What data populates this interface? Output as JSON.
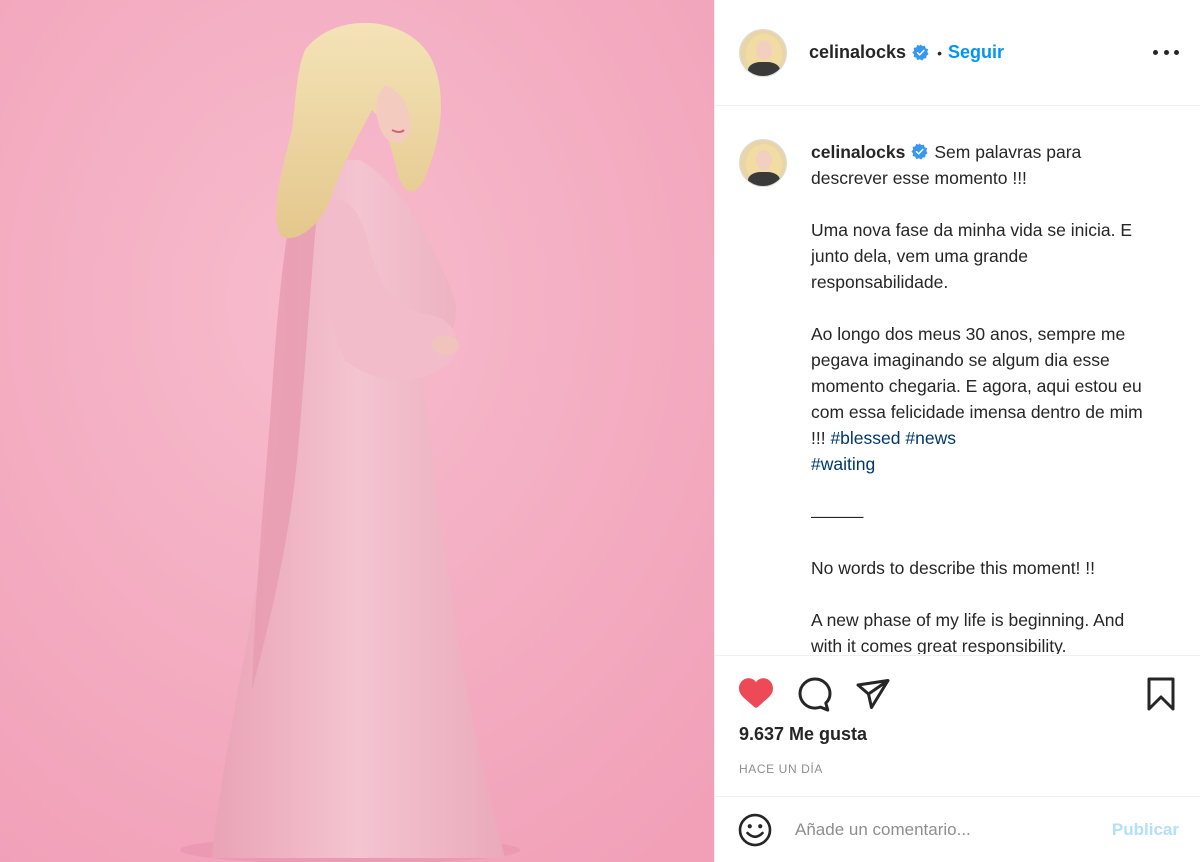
{
  "post": {
    "username": "celinalocks",
    "follow_label": "Seguir",
    "separator": "•"
  },
  "caption": {
    "username": "celinalocks",
    "paragraph1": "Sem palavras para descrever esse momento !!!",
    "paragraph2": "Uma nova fase da minha vida se inicia. E junto dela, vem uma grande responsabilidade.",
    "paragraph3": "Ao longo dos meus 30 anos, sempre me pegava imaginando se algum dia esse momento chegaria. E agora, aqui estou eu com essa felicidade imensa dentro de mim !!! ",
    "hashtags": [
      "#blessed",
      "#news",
      "#waiting"
    ],
    "divider": "———",
    "paragraph4": "No words to describe this moment! !!",
    "paragraph5": "A new phase of my life is beginning. And with it comes great responsibility."
  },
  "actions": {
    "like_icon": "heart-filled-icon",
    "comment_icon": "comment-icon",
    "share_icon": "paper-plane-icon",
    "save_icon": "bookmark-icon",
    "likes_text": "9.637 Me gusta",
    "time_text": "HACE UN DÍA"
  },
  "comment": {
    "emoji_icon": "smiley-icon",
    "placeholder": "Añade un comentario...",
    "publish_label": "Publicar"
  },
  "colors": {
    "background_pink": "#f4adc3",
    "like_red": "#ed4956",
    "link_blue": "#0095f6",
    "hashtag_blue": "#00376b",
    "verified_blue": "#3897f0",
    "publish_disabled": "#b2dffc"
  }
}
